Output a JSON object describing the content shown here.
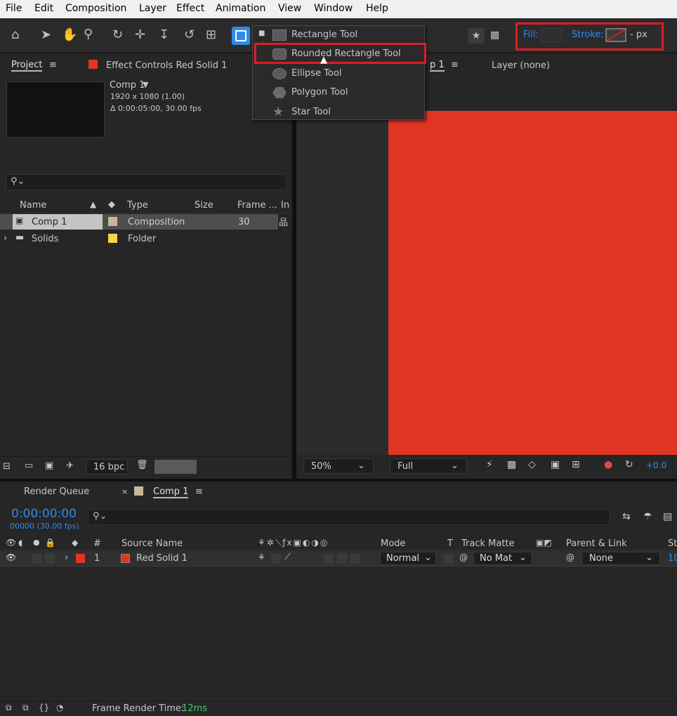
{
  "menu": [
    "File",
    "Edit",
    "Composition",
    "Layer",
    "Effect",
    "Animation",
    "View",
    "Window",
    "Help"
  ],
  "toolbar": {
    "fill_label": "Fill:",
    "stroke_label": "Stroke:",
    "stroke_width": "- px"
  },
  "shape_menu": {
    "items": [
      "Rectangle Tool",
      "Rounded Rectangle Tool",
      "Ellipse Tool",
      "Polygon Tool",
      "Star Tool"
    ],
    "highlighted": "Rounded Rectangle Tool"
  },
  "project": {
    "tab": "Project",
    "effect_controls_tab": "Effect Controls Red Solid 1",
    "comp_name": "Comp 1",
    "comp_dims": "1920 x 1080 (1.00)",
    "comp_duration": "Δ 0:00:05:00, 30.00 fps",
    "columns": [
      "Name",
      "Type",
      "Size",
      "Frame ...",
      "In"
    ],
    "rows": [
      {
        "name": "Comp 1",
        "type": "Composition",
        "size": "",
        "frame": "30",
        "color": "#c8b89a"
      },
      {
        "name": "Solids",
        "type": "Folder",
        "size": "",
        "frame": "",
        "color": "#f0d64a"
      }
    ],
    "bpc": "16 bpc"
  },
  "viewer": {
    "tab_comp": "p 1",
    "tab_layer": "Layer (none)",
    "zoom": "50%",
    "resolution": "Full",
    "exposure": "+0.0",
    "solid_color": "#e03525"
  },
  "timeline": {
    "render_queue_tab": "Render Queue",
    "comp_tab": "Comp 1",
    "timecode": "0:00:00:00",
    "frame_info": "00000 (30.00 fps)",
    "columns": {
      "number": "#",
      "source": "Source Name",
      "mode": "Mode",
      "t": "T",
      "track_matte": "Track Matte",
      "parent": "Parent & Link",
      "stretch": "St"
    },
    "layers": [
      {
        "index": "1",
        "name": "Red Solid 1",
        "mode": "Normal",
        "matte": "No Mat",
        "parent": "None",
        "stretch": "10",
        "color": "#e03525"
      }
    ]
  },
  "status": {
    "label": "Frame Render Time:",
    "value": "12ms"
  },
  "colors": {
    "accent_blue": "#2d8ceb",
    "highlight_red": "#e01b24",
    "solid_red": "#e03525"
  }
}
